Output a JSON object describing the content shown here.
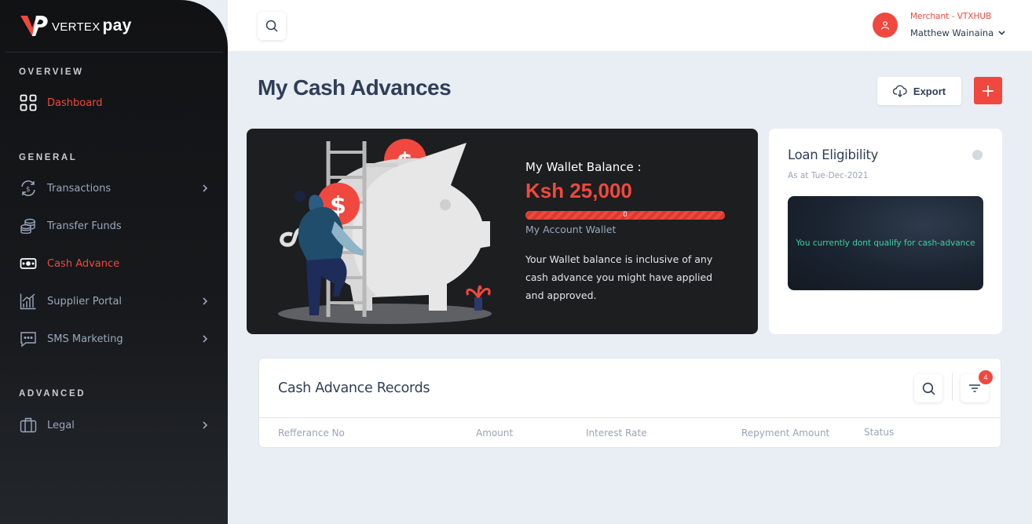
{
  "brand": {
    "name": "VERTEX",
    "suffix": "pay"
  },
  "sidebar": {
    "sections": [
      "OVERVIEW",
      "GENERAL",
      "ADVANCED"
    ],
    "items": [
      {
        "label": "Dashboard"
      },
      {
        "label": "Transactions"
      },
      {
        "label": "Transfer Funds"
      },
      {
        "label": "Cash Advance"
      },
      {
        "label": "Supplier Portal"
      },
      {
        "label": "SMS Marketing"
      },
      {
        "label": "Legal"
      }
    ]
  },
  "header": {
    "merchant": "Merchant - VTXHUB",
    "user": "Matthew Wainaina"
  },
  "page": {
    "title": "My Cash Advances",
    "export_label": "Export"
  },
  "wallet": {
    "title": "My Wallet Balance :",
    "amount": "Ksh 25,000",
    "bar_value": "0",
    "subtitle": "My Account Wallet",
    "description": "Your Wallet balance is inclusive of any cash advance you might have applied and approved."
  },
  "loan": {
    "title": "Loan Eligibility",
    "date": "As at Tue-Dec-2021",
    "message": "You currently dont qualify for cash-advance"
  },
  "records": {
    "title": "Cash Advance Records",
    "filter_count": "4",
    "columns": [
      "Refferance No",
      "Amount",
      "Interest Rate",
      "Repyment Amount",
      "Status"
    ]
  },
  "colors": {
    "accent": "#f0483e",
    "dark": "#1d1e20",
    "text": "#2f3e57",
    "success": "#38d39f"
  }
}
